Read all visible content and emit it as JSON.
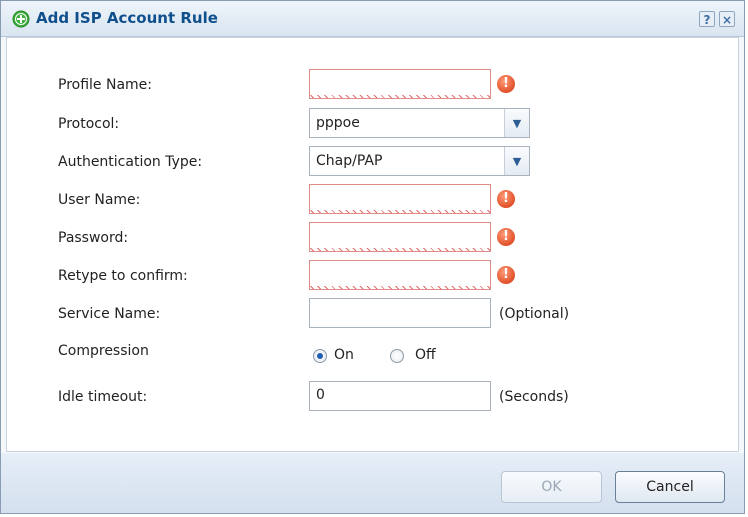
{
  "dialog": {
    "title": "Add ISP Account Rule",
    "help_glyph": "?",
    "close_glyph": "×"
  },
  "form": {
    "profile_name": {
      "label": "Profile Name:",
      "value": "",
      "invalid": true
    },
    "protocol": {
      "label": "Protocol:",
      "value": "pppoe"
    },
    "auth_type": {
      "label": "Authentication Type:",
      "value": "Chap/PAP"
    },
    "user_name": {
      "label": "User Name:",
      "value": "",
      "invalid": true
    },
    "password": {
      "label": "Password:",
      "value": "",
      "invalid": true
    },
    "retype": {
      "label": "Retype to confirm:",
      "value": "",
      "invalid": true
    },
    "service_name": {
      "label": "Service Name:",
      "value": "",
      "hint": "(Optional)"
    },
    "compression": {
      "label": "Compression",
      "on_label": "On",
      "off_label": "Off",
      "selected": "On"
    },
    "idle_timeout": {
      "label": "Idle timeout:",
      "value": "0",
      "hint": "(Seconds)"
    }
  },
  "buttons": {
    "ok": "OK",
    "cancel": "Cancel"
  },
  "icons": {
    "title": "add-circle-icon",
    "error": "error-exclamation-icon",
    "dropdown": "chevron-down-icon"
  },
  "colors": {
    "title": "#0f4f8c",
    "error": "#e0512a",
    "radio_selected": "#1f5fb4"
  }
}
